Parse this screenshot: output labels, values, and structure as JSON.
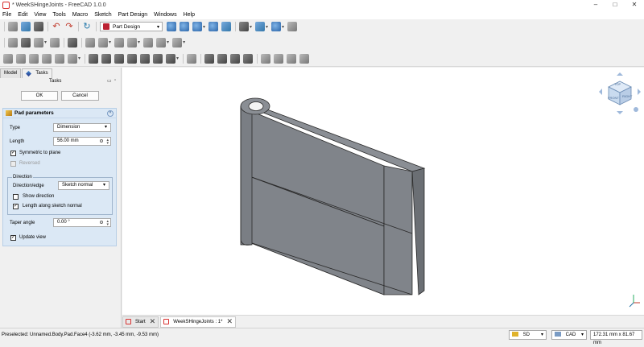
{
  "window": {
    "title": "* WeekSHingeJoints - FreeCAD 1.0.0",
    "controls": {
      "minimize": "–",
      "maximize": "□",
      "close": "✕"
    }
  },
  "menu": [
    "File",
    "Edit",
    "View",
    "Tools",
    "Macro",
    "Sketch",
    "Part Design",
    "Windows",
    "Help"
  ],
  "toolbar": {
    "workbench": "Part Design"
  },
  "panel": {
    "tabs": {
      "model": "Model",
      "tasks": "Tasks"
    },
    "tasks_label": "Tasks",
    "ok": "OK",
    "cancel": "Cancel",
    "pad": {
      "title": "Pad parameters",
      "type_label": "Type",
      "type_value": "Dimension",
      "length_label": "Length",
      "length_value": "56.00 mm",
      "symmetric_label": "Symmetric to plane",
      "symmetric_checked": "✓",
      "reversed_label": "Reversed",
      "direction_title": "Direction",
      "direction_edge_label": "Direction/edge",
      "direction_edge_value": "Sketch normal",
      "show_direction_label": "Show direction",
      "length_along_label": "Length along sketch normal",
      "length_along_checked": "✓",
      "taper_label": "Taper angle",
      "taper_value": "0.00 °",
      "update_view_label": "Update view",
      "update_view_checked": "✓"
    }
  },
  "navcube": {
    "face_front": "FRONT",
    "face_top": "TOP",
    "face_right": "RIGHT"
  },
  "doc_tabs": [
    {
      "label": "Start"
    },
    {
      "label": "WeekSHingeJoints : 1*"
    }
  ],
  "status": {
    "message": "Preselected: Unnamed.Body.Pad.Face4 (-3.62 mm, -3.45 mm, -9.53 mm)",
    "nav_style": "SD",
    "units": "CAD",
    "dimensions": "172.31 mm x 81.67 mm"
  },
  "colors": {
    "model_face": "#80848a",
    "model_side": "#6b6f74",
    "panel_bg": "#dbe8f5",
    "accent": "#d8302f"
  }
}
